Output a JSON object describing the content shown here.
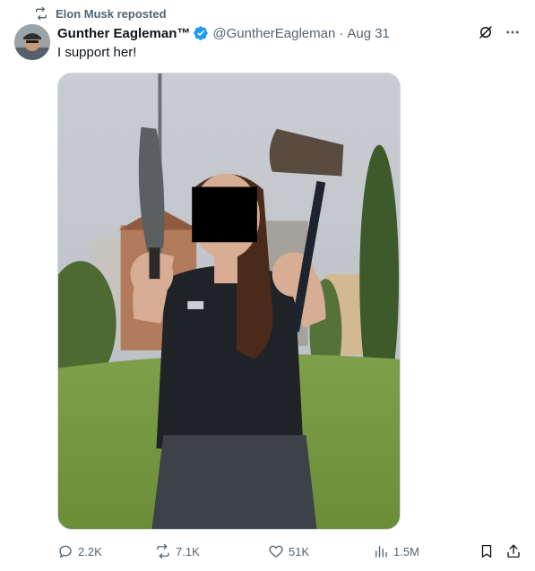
{
  "repost": {
    "label": "Elon Musk reposted",
    "icon": "repost-icon"
  },
  "author": {
    "display_name": "Gunther Eagleman™",
    "handle": "@GuntherEagleman",
    "separator": "·",
    "date": "Aug 31",
    "verified_color": "#1d9bf0"
  },
  "tweet": {
    "text": "I support her!"
  },
  "metrics": {
    "replies": "2.2K",
    "reposts": "7.1K",
    "likes": "51K",
    "views": "1.5M"
  },
  "colors": {
    "muted": "#536471",
    "text": "#0f1419",
    "accent": "#1d9bf0",
    "border": "#cfd9de"
  }
}
